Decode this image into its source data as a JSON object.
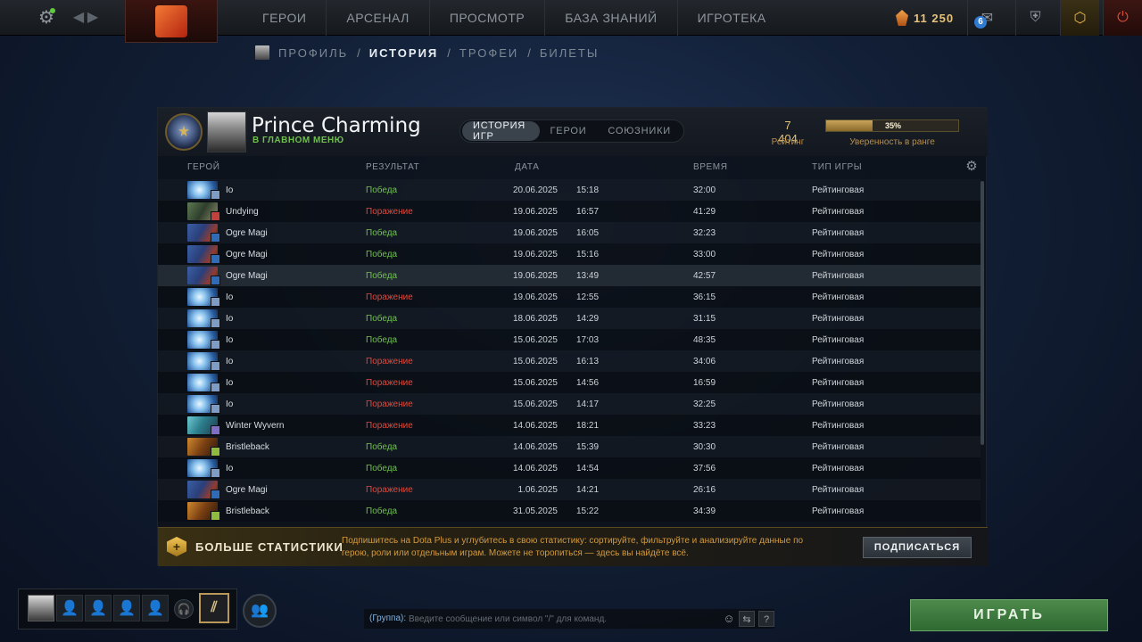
{
  "topbar": {
    "nav": [
      "ГЕРОИ",
      "АРСЕНАЛ",
      "ПРОСМОТР",
      "БАЗА ЗНАНИЙ",
      "ИГРОТЕКА"
    ],
    "currency_value": "11 250",
    "notification_count": "6",
    "icons": {
      "settings": "gear-icon",
      "back": "chevron-left-icon",
      "forward": "chevron-right-icon",
      "logo": "dota-logo-icon",
      "shards": "shard-icon",
      "messages": "mail-icon",
      "armory": "shield-swords-icon",
      "plus": "dota-plus-icon",
      "power": "power-icon"
    },
    "colors": {
      "online_dot": "#5ecb3e",
      "currency": "#e6c27a"
    }
  },
  "subnav": {
    "items": [
      "ПРОФИЛЬ",
      "ИСТОРИЯ",
      "ТРОФЕИ",
      "БИЛЕТЫ"
    ],
    "active_index": 1,
    "separator": "/"
  },
  "profile": {
    "name": "Prince Charming",
    "status": "В ГЛАВНОМ МЕНЮ",
    "tabs": [
      "ИСТОРИЯ ИГР",
      "ГЕРОИ",
      "СОЮЗНИКИ"
    ],
    "active_tab": 0,
    "rating_value": "7 404",
    "rating_label": "Рейтинг",
    "confidence_pct": "35%",
    "confidence_fraction": 0.35,
    "confidence_label": "Уверенность в ранге"
  },
  "table": {
    "headers": {
      "hero": "ГЕРОЙ",
      "result": "РЕЗУЛЬТАТ",
      "date": "ДАТА",
      "duration": "ВРЕМЯ",
      "type": "ТИП ИГРЫ"
    },
    "highlighted_row": 4,
    "rows": [
      {
        "hero": "Io",
        "hero_key": "io",
        "role": "carry",
        "result": "Победа",
        "win": true,
        "date": "20.06.2025",
        "time": "15:18",
        "duration": "32:00",
        "type": "Рейтинговая"
      },
      {
        "hero": "Undying",
        "hero_key": "undying",
        "role": "offlane",
        "result": "Поражение",
        "win": false,
        "date": "19.06.2025",
        "time": "16:57",
        "duration": "41:29",
        "type": "Рейтинговая"
      },
      {
        "hero": "Ogre Magi",
        "hero_key": "ogre",
        "role": "support",
        "result": "Победа",
        "win": true,
        "date": "19.06.2025",
        "time": "16:05",
        "duration": "32:23",
        "type": "Рейтинговая"
      },
      {
        "hero": "Ogre Magi",
        "hero_key": "ogre",
        "role": "support",
        "result": "Победа",
        "win": true,
        "date": "19.06.2025",
        "time": "15:16",
        "duration": "33:00",
        "type": "Рейтинговая"
      },
      {
        "hero": "Ogre Magi",
        "hero_key": "ogre",
        "role": "support",
        "result": "Победа",
        "win": true,
        "date": "19.06.2025",
        "time": "13:49",
        "duration": "42:57",
        "type": "Рейтинговая"
      },
      {
        "hero": "Io",
        "hero_key": "io",
        "role": "carry",
        "result": "Поражение",
        "win": false,
        "date": "19.06.2025",
        "time": "12:55",
        "duration": "36:15",
        "type": "Рейтинговая"
      },
      {
        "hero": "Io",
        "hero_key": "io",
        "role": "carry",
        "result": "Победа",
        "win": true,
        "date": "18.06.2025",
        "time": "14:29",
        "duration": "31:15",
        "type": "Рейтинговая"
      },
      {
        "hero": "Io",
        "hero_key": "io",
        "role": "carry",
        "result": "Победа",
        "win": true,
        "date": "15.06.2025",
        "time": "17:03",
        "duration": "48:35",
        "type": "Рейтинговая"
      },
      {
        "hero": "Io",
        "hero_key": "io",
        "role": "carry",
        "result": "Поражение",
        "win": false,
        "date": "15.06.2025",
        "time": "16:13",
        "duration": "34:06",
        "type": "Рейтинговая"
      },
      {
        "hero": "Io",
        "hero_key": "io",
        "role": "carry",
        "result": "Поражение",
        "win": false,
        "date": "15.06.2025",
        "time": "14:56",
        "duration": "16:59",
        "type": "Рейтинговая"
      },
      {
        "hero": "Io",
        "hero_key": "io",
        "role": "carry",
        "result": "Поражение",
        "win": false,
        "date": "15.06.2025",
        "time": "14:17",
        "duration": "32:25",
        "type": "Рейтинговая"
      },
      {
        "hero": "Winter Wyvern",
        "hero_key": "wyvern",
        "role": "mid",
        "result": "Поражение",
        "win": false,
        "date": "14.06.2025",
        "time": "18:21",
        "duration": "33:23",
        "type": "Рейтинговая"
      },
      {
        "hero": "Bristleback",
        "hero_key": "bristle",
        "role": "core",
        "result": "Победа",
        "win": true,
        "date": "14.06.2025",
        "time": "15:39",
        "duration": "30:30",
        "type": "Рейтинговая"
      },
      {
        "hero": "Io",
        "hero_key": "io",
        "role": "carry",
        "result": "Победа",
        "win": true,
        "date": "14.06.2025",
        "time": "14:54",
        "duration": "37:56",
        "type": "Рейтинговая"
      },
      {
        "hero": "Ogre Magi",
        "hero_key": "ogre",
        "role": "support",
        "result": "Поражение",
        "win": false,
        "date": "1.06.2025",
        "time": "14:21",
        "duration": "26:16",
        "type": "Рейтинговая"
      },
      {
        "hero": "Bristleback",
        "hero_key": "bristle",
        "role": "core",
        "result": "Победа",
        "win": true,
        "date": "31.05.2025",
        "time": "15:22",
        "duration": "34:39",
        "type": "Рейтинговая"
      }
    ],
    "colors": {
      "win": "#6ec14c",
      "loss": "#e0483a"
    }
  },
  "plus_banner": {
    "title": "БОЛЬШЕ СТАТИСТИКИ",
    "description": "Подпишитесь на Dota Plus и углубитесь в свою статистику: сортируйте, фильтруйте и анализируйте данные по герою, роли или отдельным играм. Можете не торопиться — здесь вы найдёте всё.",
    "button": "ПОДПИСАТЬСЯ",
    "badge_symbol": "+"
  },
  "bottom": {
    "chat_label": "(Группа):",
    "chat_placeholder": "Введите сообщение или символ \"/\" для команд.",
    "help_symbol": "?",
    "play_label": "ИГРАТЬ",
    "colors": {
      "play": "#3f7c40"
    }
  }
}
